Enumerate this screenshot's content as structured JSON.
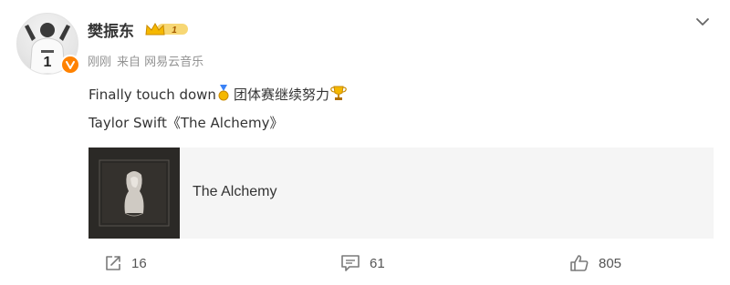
{
  "post": {
    "author": {
      "name": "樊振东",
      "vip_level": "1"
    },
    "meta": {
      "time": "刚刚",
      "source_prefix": "来自",
      "source": "网易云音乐"
    },
    "text": {
      "line1_part1": "Finally touch down",
      "line1_part2": "团体赛继续努力",
      "line2": "Taylor Swift《The Alchemy》"
    },
    "music_card": {
      "title": "The Alchemy"
    },
    "actions": {
      "share_count": "16",
      "comment_count": "61",
      "like_count": "805"
    },
    "colors": {
      "accent_orange": "#ff8200",
      "muted_text": "#939393",
      "card_bg": "#f5f5f5"
    },
    "icons": [
      "avatar",
      "verified-icon",
      "vip-crown-icon",
      "chevron-down-icon",
      "medal-emoji-icon",
      "trophy-emoji-icon",
      "share-icon",
      "comment-icon",
      "like-icon"
    ]
  }
}
